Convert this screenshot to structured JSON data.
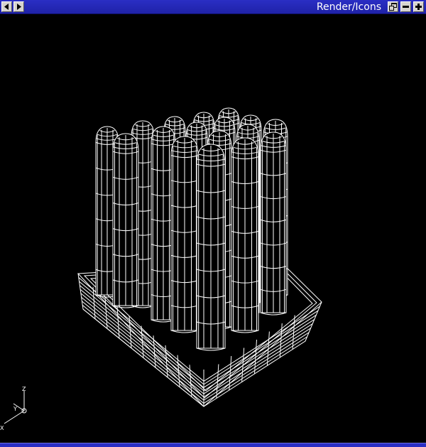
{
  "window": {
    "title": "Render/Icons",
    "titlebar_color": "#2a2ec4",
    "background_color": "#000000",
    "wire_color": "#ffffff"
  },
  "titlebar_buttons": {
    "left": [
      "scroll-left-icon",
      "scroll-right-icon"
    ],
    "right": [
      "restore-icon",
      "minimize-icon",
      "close-icon"
    ]
  },
  "axis_triad": {
    "labels": [
      "Z",
      "Y",
      "X"
    ]
  },
  "scene": {
    "object": "wireframe-tray-with-rounded-rods",
    "render_mode": "wireframe",
    "rod_count": 16
  }
}
